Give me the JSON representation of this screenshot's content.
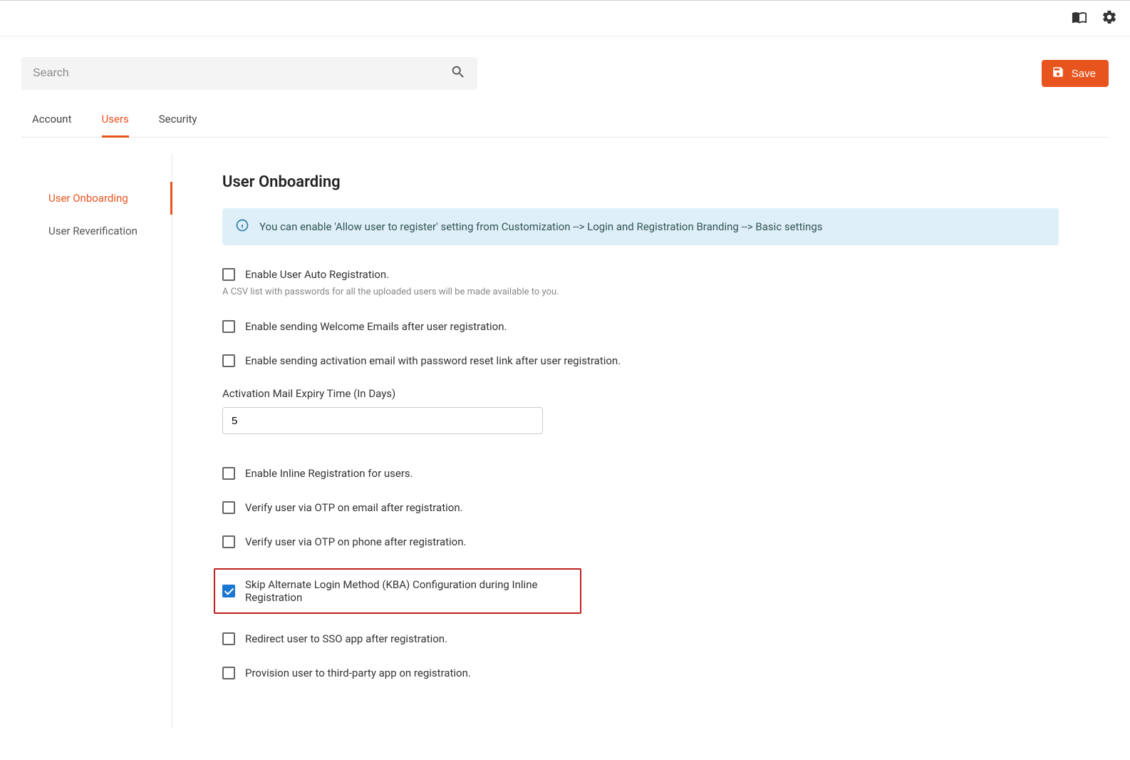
{
  "header": {
    "book_icon": "book-icon",
    "gear_icon": "gear-icon"
  },
  "search": {
    "placeholder": "Search"
  },
  "toolbar": {
    "save_label": "Save"
  },
  "tabs": [
    {
      "label": "Account",
      "active": false
    },
    {
      "label": "Users",
      "active": true
    },
    {
      "label": "Security",
      "active": false
    }
  ],
  "sidebar": {
    "items": [
      {
        "label": "User Onboarding",
        "active": true
      },
      {
        "label": "User Reverification",
        "active": false
      }
    ]
  },
  "main": {
    "title": "User Onboarding",
    "info": "You can enable 'Allow user to register' setting from Customization --> Login and Registration Branding --> Basic settings",
    "hint": "A CSV list with passwords for all the uploaded users will be made available to you.",
    "expiry_label": "Activation Mail Expiry Time (In Days)",
    "expiry_value": "5",
    "checks": [
      {
        "label": "Enable User Auto Registration.",
        "checked": false
      },
      {
        "label": "Enable sending Welcome Emails after user registration.",
        "checked": false
      },
      {
        "label": "Enable sending activation email with password reset link after user registration.",
        "checked": false
      },
      {
        "label": "Enable Inline Registration for users.",
        "checked": false
      },
      {
        "label": "Verify user via OTP on email after registration.",
        "checked": false
      },
      {
        "label": "Verify user via OTP on phone after registration.",
        "checked": false
      },
      {
        "label": "Skip Alternate Login Method (KBA) Configuration during Inline Registration",
        "checked": true,
        "highlighted": true
      },
      {
        "label": "Redirect user to SSO app after registration.",
        "checked": false
      },
      {
        "label": "Provision user to third-party app on registration.",
        "checked": false
      }
    ]
  }
}
